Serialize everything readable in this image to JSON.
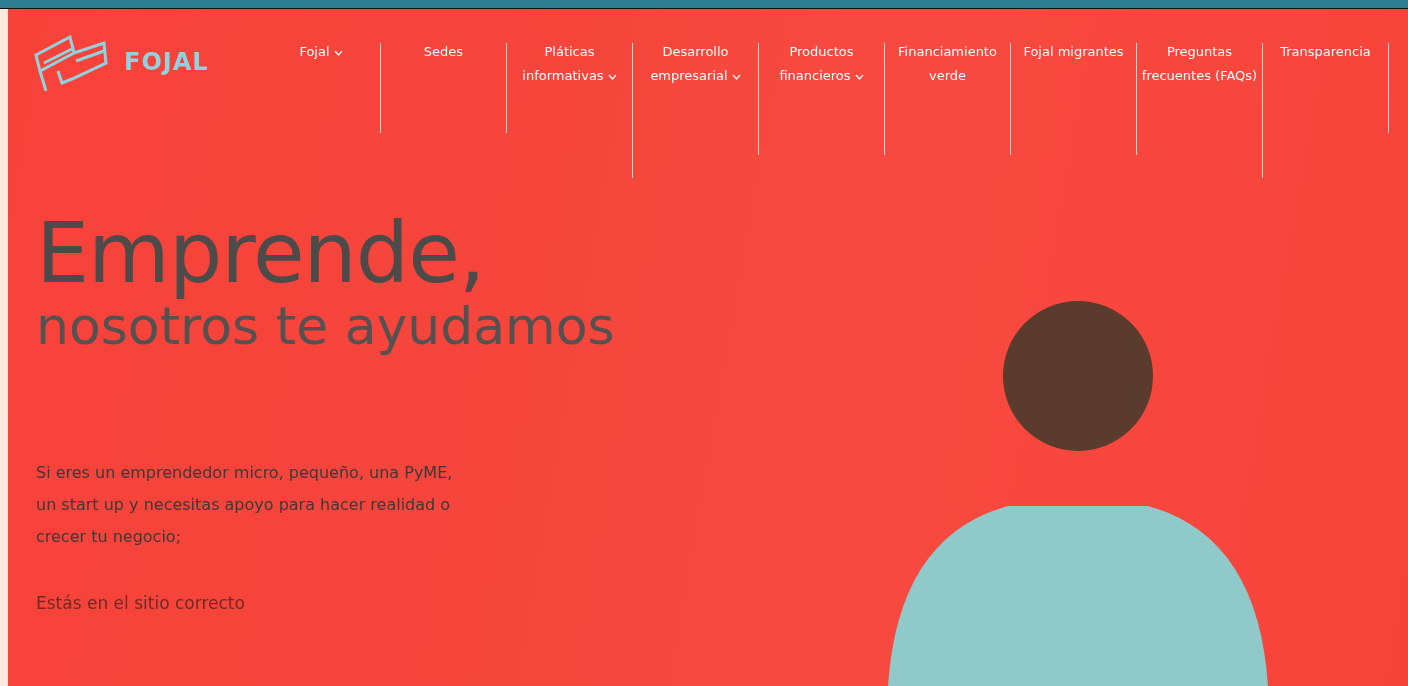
{
  "logo": {
    "text": "FOJAL"
  },
  "nav": [
    {
      "label": "Fojal",
      "dropdown": true
    },
    {
      "label": "Sedes",
      "dropdown": false
    },
    {
      "label": "Pláticas informativas",
      "dropdown": true
    },
    {
      "label": "Desarrollo empresarial",
      "dropdown": true
    },
    {
      "label": "Productos financieros",
      "dropdown": true
    },
    {
      "label": "Financiamiento verde",
      "dropdown": false
    },
    {
      "label": "Fojal migrantes",
      "dropdown": false
    },
    {
      "label": "Preguntas frecuentes (FAQs)",
      "dropdown": false
    },
    {
      "label": "Transparencia",
      "dropdown": false
    }
  ],
  "hero": {
    "title": "Emprende,",
    "subtitle": "nosotros te ayudamos",
    "body": "Si eres un emprendedor micro, pequeño, una PyME, un start up y necesitas apoyo para hacer realidad o crecer tu negocio;",
    "tagline": "Estás en el sitio correcto"
  }
}
